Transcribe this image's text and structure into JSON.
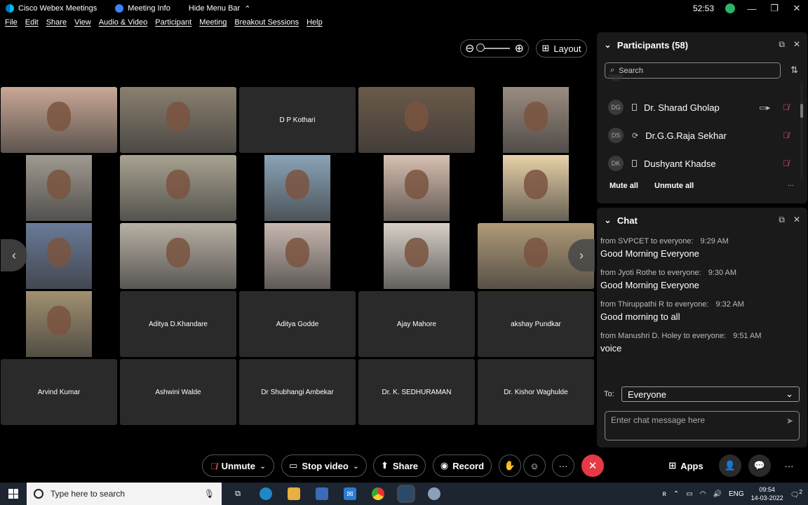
{
  "titlebar": {
    "app_name": "Cisco Webex Meetings",
    "meeting_info": "Meeting Info",
    "hide_menu": "Hide Menu Bar",
    "timer": "52:53",
    "window_controls": [
      "minimize-icon",
      "restore-icon",
      "close-icon"
    ]
  },
  "menu": [
    "File",
    "Edit",
    "Share",
    "View",
    "Audio & Video",
    "Participant",
    "Meeting",
    "Breakout Sessions",
    "Help"
  ],
  "layout_label": "Layout",
  "tiles": [
    {
      "name": "",
      "video": true,
      "color": "#c9a896"
    },
    {
      "name": "",
      "video": true,
      "color": "#8a8070"
    },
    {
      "name": "D P Kothari",
      "video": false
    },
    {
      "name": "",
      "video": true,
      "color": "#6b5a4a"
    },
    {
      "name": "",
      "video": true,
      "color": "#9b8c80",
      "narrow": true
    },
    {
      "name": "",
      "video": true,
      "color": "#a09a90",
      "narrow": true
    },
    {
      "name": "",
      "video": true,
      "color": "#a8a290"
    },
    {
      "name": "",
      "video": true,
      "color": "#8ba4b8",
      "narrow": true
    },
    {
      "name": "",
      "video": true,
      "color": "#d8c0b0",
      "narrow": true
    },
    {
      "name": "",
      "video": true,
      "color": "#e8d2a8",
      "narrow": true
    },
    {
      "name": "",
      "video": true,
      "color": "#6a7a98",
      "narrow": true
    },
    {
      "name": "",
      "video": true,
      "color": "#b8b0a4"
    },
    {
      "name": "",
      "video": true,
      "color": "#c8b8b0",
      "narrow": true
    },
    {
      "name": "",
      "video": true,
      "color": "#d8d0c8",
      "narrow": true
    },
    {
      "name": "",
      "video": true,
      "color": "#b09a78"
    },
    {
      "name": "",
      "video": true,
      "color": "#a09070",
      "narrow": true
    },
    {
      "name": "Aditya D.Khandare",
      "video": false
    },
    {
      "name": "Aditya Godde",
      "video": false
    },
    {
      "name": "Ajay Mahore",
      "video": false
    },
    {
      "name": "akshay Pundkar",
      "video": false
    },
    {
      "name": "Arvind Kumar",
      "video": false
    },
    {
      "name": "Ashwini Walde",
      "video": false
    },
    {
      "name": "Dr Shubhangi Ambekar",
      "video": false
    },
    {
      "name": "Dr. K. SEDHURAMAN",
      "video": false
    },
    {
      "name": "Dr. Kishor Waghulde",
      "video": false
    }
  ],
  "participants": {
    "title": "Participants (58)",
    "search_placeholder": "Search",
    "list": [
      {
        "initials": "DG",
        "name": "Dr. Sharad Gholap",
        "camera": true
      },
      {
        "initials": "DS",
        "name": "Dr.G.G.Raja Sekhar",
        "camera": false
      },
      {
        "initials": "DK",
        "name": "Dushyant Khadse",
        "camera": false
      }
    ],
    "mute_all": "Mute all",
    "unmute_all": "Unmute all",
    "more": "..."
  },
  "chat": {
    "title": "Chat",
    "messages": [
      {
        "meta": "from SVPCET to everyone:",
        "time": "9:29 AM",
        "text": "Good Morning Everyone"
      },
      {
        "meta": "from Jyoti Rothe to everyone:",
        "time": "9:30 AM",
        "text": "Good Morning Everyone"
      },
      {
        "meta": "from Thiruppathi R to everyone:",
        "time": "9:32 AM",
        "text": "Good morning to all"
      },
      {
        "meta": "from Manushri D. Holey to everyone:",
        "time": "9:51 AM",
        "text": "voice"
      }
    ],
    "to_label": "To:",
    "to_value": "Everyone",
    "input_placeholder": "Enter chat message here"
  },
  "controls": {
    "unmute": "Unmute",
    "stop_video": "Stop video",
    "share": "Share",
    "record": "Record",
    "apps": "Apps"
  },
  "taskbar": {
    "search_placeholder": "Type here to search",
    "lang": "ENG",
    "time": "09:54",
    "date": "14-03-2022",
    "notif_count": "2"
  }
}
